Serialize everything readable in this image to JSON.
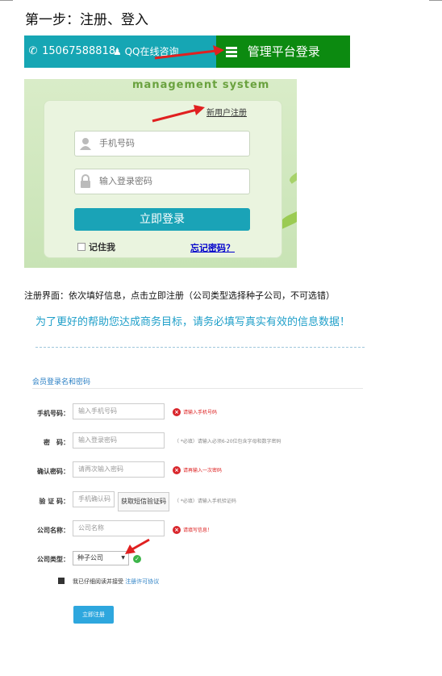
{
  "step_title": "第一步：注册、登入",
  "topbar": {
    "phone": "15067588818",
    "qq": "QQ在线咨询",
    "admin": "管理平台登录"
  },
  "login": {
    "system_name": "management system",
    "register_link": "新用户注册",
    "phone_placeholder": "手机号码",
    "password_placeholder": "输入登录密码",
    "login_button": "立即登录",
    "remember": "记住我",
    "forgot": "忘记密码？"
  },
  "description": "注册界面：依次填好信息，点击立即注册（公司类型选择种子公司，不可选错）",
  "form": {
    "banner": "为了更好的帮助您达成商务目标，请务必填写真实有效的信息数据！",
    "section_title": "会员登录名和密码",
    "rows": {
      "phone": {
        "label": "手机号码：",
        "placeholder": "输入手机号码",
        "error": "请输入手机号码"
      },
      "password": {
        "label": "密　码：",
        "placeholder": "输入登录密码",
        "hint": "（ *必填）请输入必须6-20位包含字母和数字密码"
      },
      "confirm": {
        "label": "确认密码：",
        "placeholder": "请再次输入密码",
        "error": "请再输入一次密码"
      },
      "code": {
        "label": "验 证 码：",
        "placeholder": "手机确认码",
        "button": "获取短信验证码",
        "hint": "（ *必填）请输入手机验证码"
      },
      "company_name": {
        "label": "公司名称：",
        "placeholder": "公司名称",
        "error": "请填写信息！"
      },
      "company_type": {
        "label": "公司类型：",
        "selected": "种子公司"
      }
    },
    "agree_text": "我已仔细阅读并接受",
    "agree_link": "注册许可协议",
    "submit": "立即注册"
  },
  "colors": {
    "teal": "#16a6b4",
    "green": "#0c8a10",
    "link_blue": "#2a7fc4",
    "error_red": "#d9262c",
    "arrow_red": "#e02020"
  }
}
